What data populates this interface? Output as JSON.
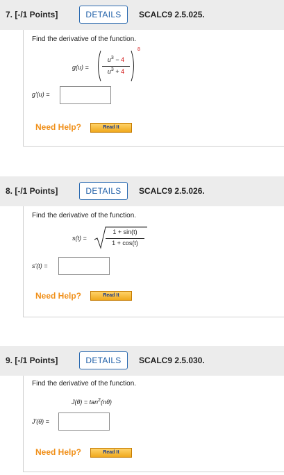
{
  "questions": [
    {
      "number": "7.  [-/1 Points]",
      "details_label": "DETAILS",
      "code": "SCALC9 2.5.025.",
      "prompt": "Find the derivative of the function.",
      "func_lhs": "g(u) =",
      "numerator_a": "u",
      "numerator_b": "3",
      "numerator_c": " − ",
      "numerator_d": "4",
      "denominator_a": "u",
      "denominator_b": "3",
      "denominator_c": " + ",
      "denominator_d": "4",
      "exponent": "8",
      "answer_label": "g'(u) =",
      "answer_value": "",
      "help_label": "Need Help?",
      "read_label": "Read It"
    },
    {
      "number": "8.  [-/1 Points]",
      "details_label": "DETAILS",
      "code": "SCALC9 2.5.026.",
      "prompt": "Find the derivative of the function.",
      "func_lhs": "s(t) =",
      "numerator": "1 + sin(t)",
      "denominator": "1 + cos(t)",
      "answer_label": "s'(t) =",
      "answer_value": "",
      "help_label": "Need Help?",
      "read_label": "Read It"
    },
    {
      "number": "9.  [-/1 Points]",
      "details_label": "DETAILS",
      "code": "SCALC9 2.5.030.",
      "prompt": "Find the derivative of the function.",
      "func": "J(θ) = tan",
      "func_exp": "2",
      "func_tail": "(nθ)",
      "answer_label": "J'(θ) =",
      "answer_value": "",
      "help_label": "Need Help?",
      "read_label": "Read It"
    }
  ]
}
